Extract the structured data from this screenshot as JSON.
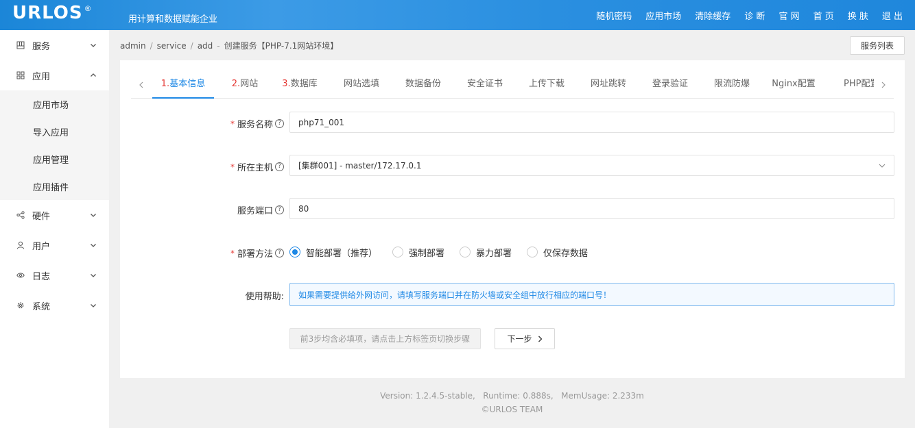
{
  "header": {
    "logo": "URLOS",
    "logo_mark": "®",
    "slogan": "用计算和数据赋能企业",
    "nav": [
      "随机密码",
      "应用市场",
      "清除缓存",
      "诊 断",
      "官 网",
      "首 页",
      "换 肤",
      "退 出"
    ]
  },
  "sidebar": {
    "items": [
      {
        "label": "服务",
        "icon": "grid-icon"
      },
      {
        "label": "应用",
        "icon": "apps-icon"
      },
      {
        "label": "硬件",
        "icon": "share-icon"
      },
      {
        "label": "用户",
        "icon": "user-icon"
      },
      {
        "label": "日志",
        "icon": "eye-icon"
      },
      {
        "label": "系统",
        "icon": "gear-icon"
      }
    ],
    "app_sub": [
      "应用市场",
      "导入应用",
      "应用管理",
      "应用插件"
    ]
  },
  "breadcrumb": [
    "admin",
    "service",
    "add"
  ],
  "breadcrumb_tail": "创建服务【PHP-7.1网站环境】",
  "list_button": "服务列表",
  "tabs": [
    {
      "num": "1.",
      "label": "基本信息"
    },
    {
      "num": "2.",
      "label": "网站"
    },
    {
      "num": "3.",
      "label": "数据库"
    },
    {
      "num": "",
      "label": "网站选填"
    },
    {
      "num": "",
      "label": "数据备份"
    },
    {
      "num": "",
      "label": "安全证书"
    },
    {
      "num": "",
      "label": "上传下载"
    },
    {
      "num": "",
      "label": "网址跳转"
    },
    {
      "num": "",
      "label": "登录验证"
    },
    {
      "num": "",
      "label": "限流防爆"
    },
    {
      "num": "",
      "label": "Nginx配置"
    },
    {
      "num": "",
      "label": "PHP配置"
    }
  ],
  "form": {
    "service_name_label": "服务名称",
    "service_name_value": "php71_001",
    "host_label": "所在主机",
    "host_value": "[集群001] - master/172.17.0.1",
    "port_label": "服务端口",
    "port_value": "80",
    "deploy_label": "部署方法",
    "deploy_options": [
      "智能部署（推荐）",
      "强制部署",
      "暴力部署",
      "仅保存数据"
    ],
    "deploy_selected": "智能部署（推荐）",
    "help_label": "使用帮助:",
    "help_text": "如果需要提供给外网访问，请填写服务端口并在防火墙或安全组中放行相应的端口号！",
    "hint_button": "前3步均含必填项，请点击上方标签页切换步骤",
    "next_button": "下一步"
  },
  "footer": {
    "line1": "Version: 1.2.4.5-stable,   Runtime: 0.888s,   MemUsage: 2.233m",
    "line2": "©URLOS TEAM"
  },
  "colors": {
    "accent": "#1e88e5",
    "required": "#e53935",
    "header": "#2a8fe0"
  }
}
